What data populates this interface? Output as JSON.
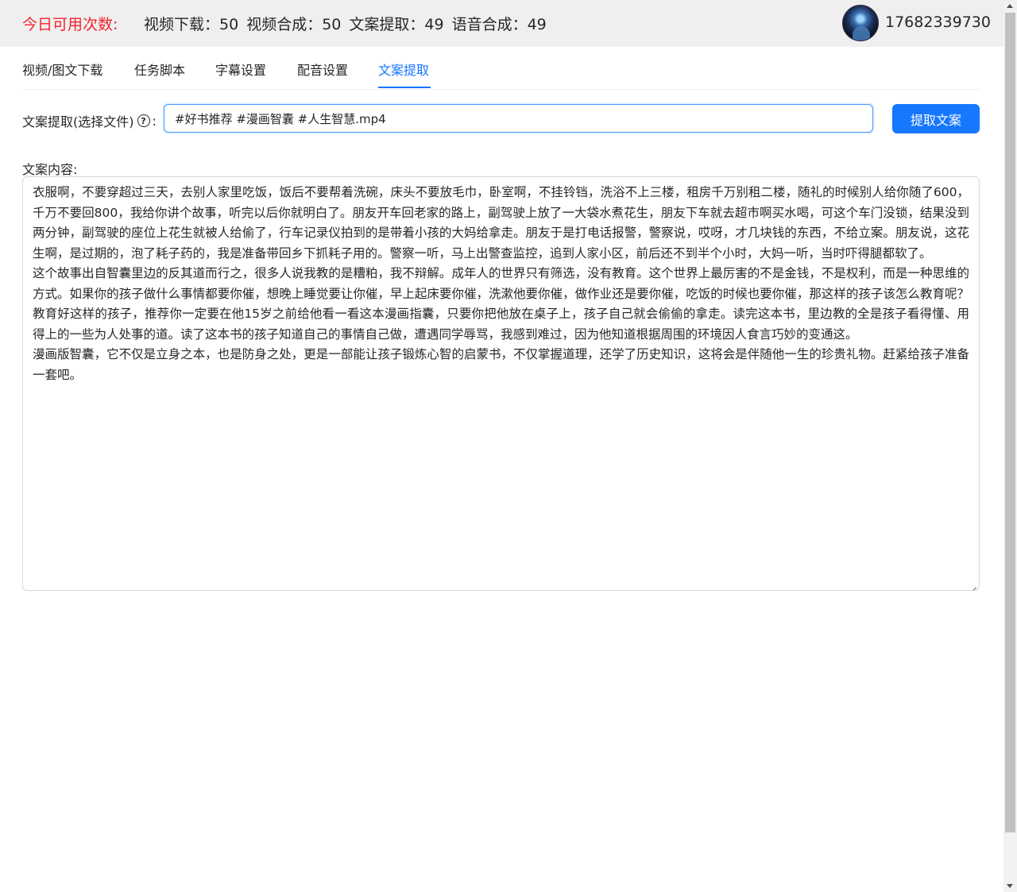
{
  "header": {
    "quota_label": "今日可用次数:",
    "quota_items": [
      "视频下载：50",
      "视频合成：50",
      "文案提取：49",
      "语音合成：49"
    ],
    "username": "17682339730"
  },
  "tabs": [
    {
      "label": "视频/图文下载",
      "active": false
    },
    {
      "label": "任务脚本",
      "active": false
    },
    {
      "label": "字幕设置",
      "active": false
    },
    {
      "label": "配音设置",
      "active": false
    },
    {
      "label": "文案提取",
      "active": true
    }
  ],
  "file_field": {
    "label": "文案提取(选择文件)",
    "colon": ":",
    "help_glyph": "?",
    "value": "#好书推荐 #漫画智囊 #人生智慧.mp4"
  },
  "extract_button": {
    "label": "提取文案"
  },
  "content": {
    "label": "文案内容:",
    "paragraphs": [
      "衣服啊，不要穿超过三天，去别人家里吃饭，饭后不要帮着洗碗，床头不要放毛巾，卧室啊，不挂铃铛，洗浴不上三楼，租房千万别租二楼，随礼的时候别人给你随了600，千万不要回800，我给你讲个故事，听完以后你就明白了。朋友开车回老家的路上，副驾驶上放了一大袋水煮花生，朋友下车就去超市啊买水喝，可这个车门没锁，结果没到两分钟，副驾驶的座位上花生就被人给偷了，行车记录仪拍到的是带着小孩的大妈给拿走。朋友于是打电话报警，警察说，哎呀，才几块钱的东西，不给立案。朋友说，这花生啊，是过期的，泡了耗子药的，我是准备带回乡下抓耗子用的。警察一听，马上出警查监控，追到人家小区，前后还不到半个小时，大妈一听，当时吓得腿都软了。",
      "这个故事出自智囊里边的反其道而行之，很多人说我教的是糟粕，我不辩解。成年人的世界只有筛选，没有教育。这个世界上最厉害的不是金钱，不是权利，而是一种思维的方式。如果你的孩子做什么事情都要你催，想晚上睡觉要让你催，早上起床要你催，洗漱他要你催，做作业还是要你催，吃饭的时候也要你催，那这样的孩子该怎么教育呢？教育好这样的孩子，推荐你一定要在他15岁之前给他看一看这本漫画指囊，只要你把他放在桌子上，孩子自己就会偷偷的拿走。读完这本书，里边教的全是孩子看得懂、用得上的一些为人处事的道。读了这本书的孩子知道自己的事情自己做，遭遇同学辱骂，我感到难过，因为他知道根据周围的环境因人食言巧妙的变通这。",
      "漫画版智囊，它不仅是立身之本，也是防身之处，更是一部能让孩子锻炼心智的启蒙书，不仅掌握道理，还学了历史知识，这将会是伴随他一生的珍贵礼物。赶紧给孩子准备一套吧。"
    ]
  },
  "colors": {
    "accent": "#1677ff",
    "quota_label": "#f5222d",
    "header_bg": "#efefef"
  }
}
